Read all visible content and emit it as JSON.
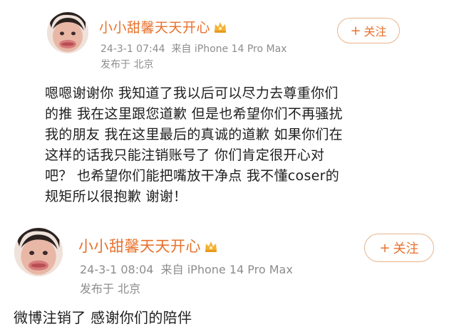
{
  "posts": [
    {
      "username": "小小甜馨天天开心",
      "timestamp": "24-3-1 07:44",
      "device": "来自 iPhone 14 Pro Max",
      "location": "发布于 北京",
      "follow_label": "关注",
      "follow_icon": "plus-icon",
      "content_lines": [
        "嗯嗯谢谢你 我知道了我以后可以尽力去尊重你们",
        "的推 我在这里跟您道歉 但是也希望你们不再骚扰",
        "我的朋友 我在这里最后的真诚的道歉 如果你们在",
        "这样的话我只能注销账号了 你们肯定很开心对",
        "吧？ 也希望你们能把嘴放干净点 我不懂coser的",
        "规矩所以很抱歉 谢谢！"
      ]
    },
    {
      "username": "小小甜馨天天开心",
      "timestamp": "24-3-1 08:04",
      "device": "来自 iPhone 14 Pro Max",
      "location": "发布于 北京",
      "follow_label": "关注",
      "follow_icon": "plus-icon",
      "content_lines": [
        "微博注销了 感谢你们的陪伴"
      ]
    }
  ],
  "colors": {
    "username": "#e8712c",
    "meta": "#8d8d8d",
    "follow_border": "#e8b48a"
  }
}
